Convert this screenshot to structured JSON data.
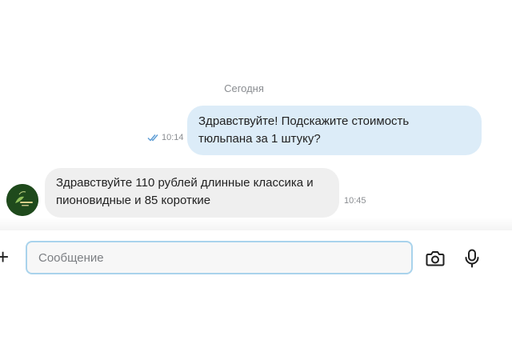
{
  "chat": {
    "date_divider": "Сегодня",
    "messages": [
      {
        "direction": "outgoing",
        "lines": [
          "Здравствуйте! Подскажите стоимость",
          "тюльпана за 1 штуку?"
        ],
        "time": "10:14",
        "status_icon": "double-check-icon",
        "read": true
      },
      {
        "direction": "incoming",
        "lines": [
          "Здравствуйте 110 рублей длинные классика и",
          "пионовидные и 85 короткие"
        ],
        "time": "10:45",
        "sender_avatar": "florist-logo-avatar"
      }
    ]
  },
  "composer": {
    "placeholder": "Сообщение",
    "value": "",
    "icons": {
      "attach": "plus-icon",
      "camera": "camera-icon",
      "voice": "microphone-icon"
    }
  },
  "colors": {
    "outgoing_bubble": "#dcecf8",
    "incoming_bubble": "#efefef",
    "input_border": "#a9d3ec",
    "read_check": "#5a9bd4",
    "avatar_bg": "#1f4a1c"
  }
}
